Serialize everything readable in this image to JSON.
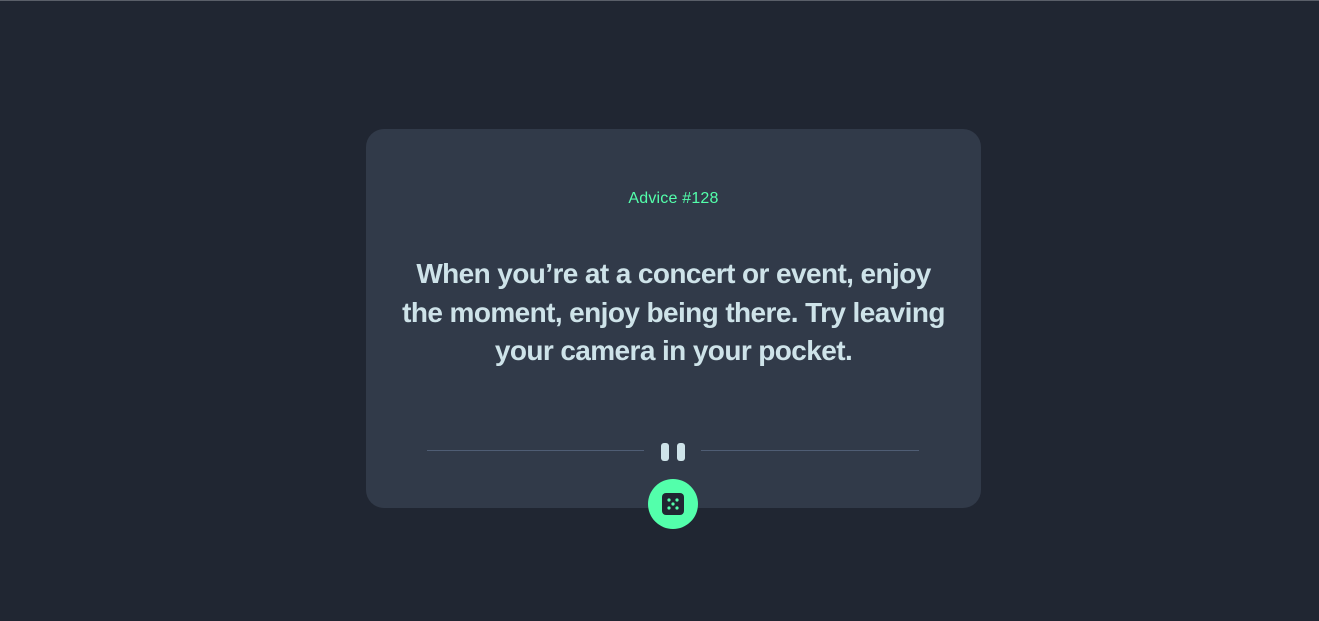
{
  "advice": {
    "label": "Advice #128",
    "text": "When you’re at a concert or event, enjoy the moment, enjoy being there. Try leaving your camera in your pocket."
  },
  "icons": {
    "divider_icon": "pause-icon",
    "button_icon": "dice-icon"
  },
  "colors": {
    "background": "#202632",
    "card": "#313a49",
    "accent": "#53ffab",
    "text": "#cee3e9",
    "divider": "#4f5d74"
  }
}
